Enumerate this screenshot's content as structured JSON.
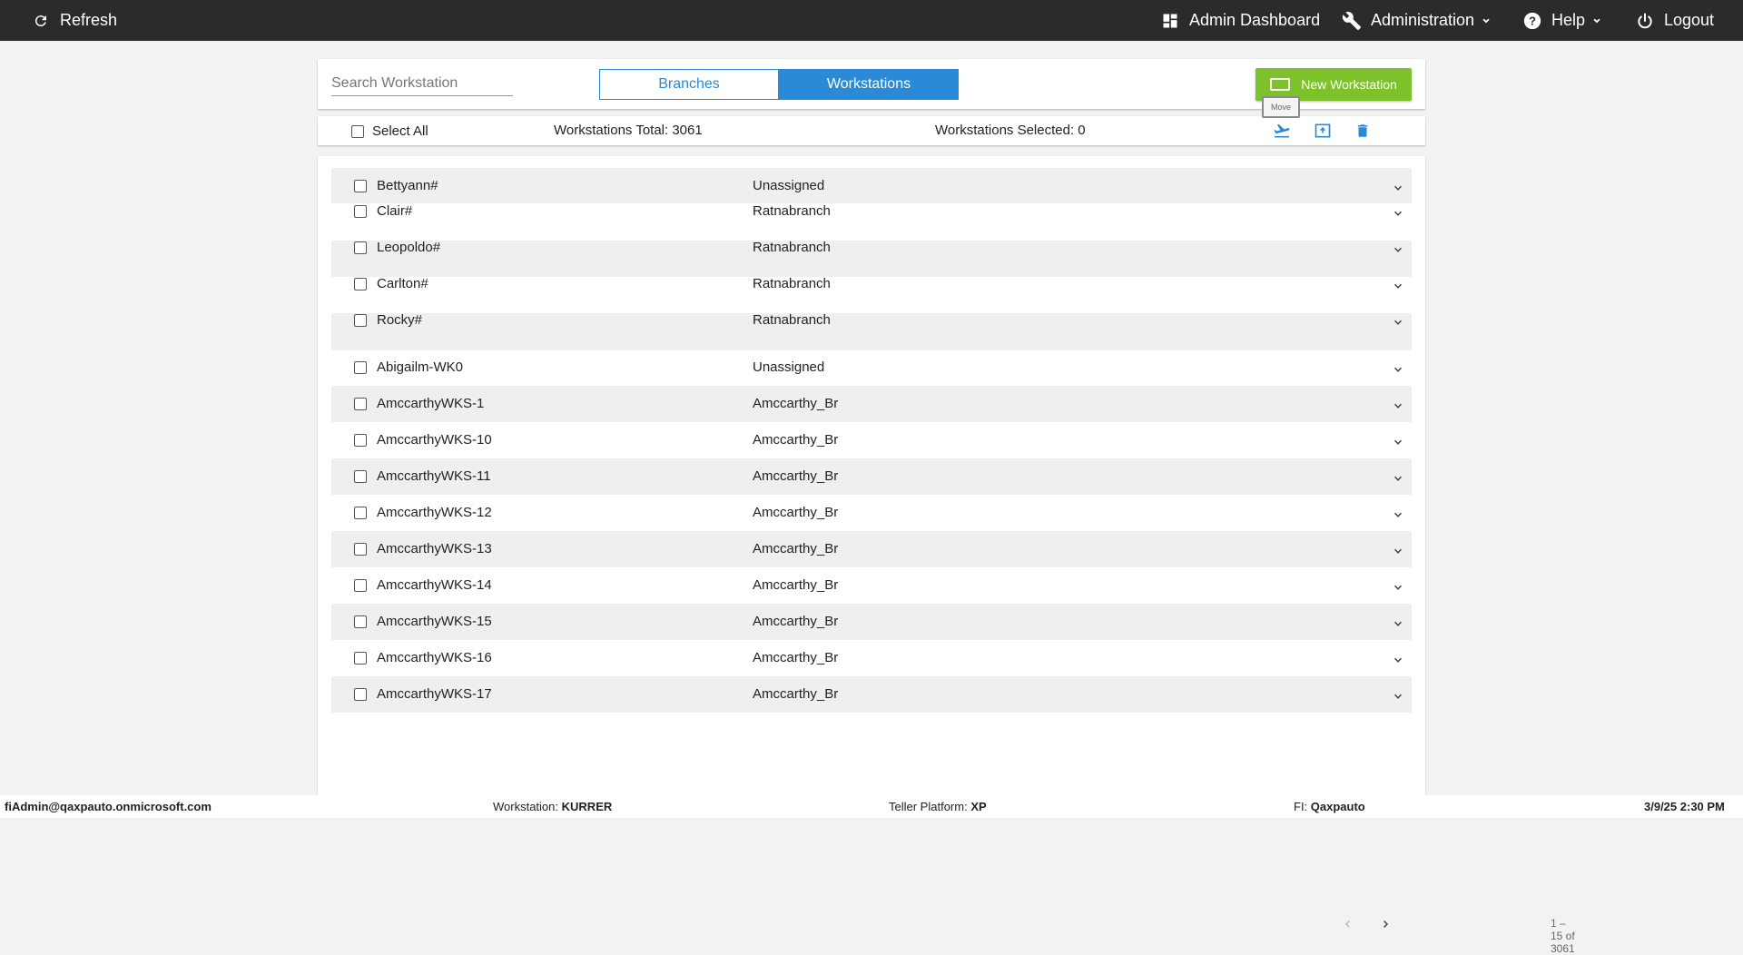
{
  "topbar": {
    "refresh_label": "Refresh",
    "admin_dashboard_label": "Admin Dashboard",
    "administration_label": "Administration",
    "help_label": "Help",
    "logout_label": "Logout"
  },
  "toolbar": {
    "search_placeholder": "Search Workstation",
    "tabs": [
      {
        "label": "Branches",
        "active": false
      },
      {
        "label": "Workstations",
        "active": true
      }
    ],
    "new_button_label": "New Workstation",
    "tooltip": "Move"
  },
  "selection": {
    "select_all_label": "Select All",
    "total_text": "Workstations Total: 3061",
    "selected_text": "Workstations Selected: 0",
    "actions": [
      "move-icon",
      "upload-icon",
      "delete-icon"
    ]
  },
  "rows": [
    {
      "name": "Bettyann#",
      "branch": "Unassigned"
    },
    {
      "name": "Clair#",
      "branch": "Ratnabranch"
    },
    {
      "name": "Leopoldo#",
      "branch": "Ratnabranch"
    },
    {
      "name": "Carlton#",
      "branch": "Ratnabranch"
    },
    {
      "name": "Rocky#",
      "branch": "Ratnabranch"
    },
    {
      "name": "Abigailm-WK0",
      "branch": "Unassigned"
    },
    {
      "name": "AmccarthyWKS-1",
      "branch": "Amccarthy_Br"
    },
    {
      "name": "AmccarthyWKS-10",
      "branch": "Amccarthy_Br"
    },
    {
      "name": "AmccarthyWKS-11",
      "branch": "Amccarthy_Br"
    },
    {
      "name": "AmccarthyWKS-12",
      "branch": "Amccarthy_Br"
    },
    {
      "name": "AmccarthyWKS-13",
      "branch": "Amccarthy_Br"
    },
    {
      "name": "AmccarthyWKS-14",
      "branch": "Amccarthy_Br"
    },
    {
      "name": "AmccarthyWKS-15",
      "branch": "Amccarthy_Br"
    },
    {
      "name": "AmccarthyWKS-16",
      "branch": "Amccarthy_Br"
    },
    {
      "name": "AmccarthyWKS-17",
      "branch": "Amccarthy_Br"
    }
  ],
  "pagination": {
    "range_text": "1 – 15 of 3061"
  },
  "footer": {
    "user": "fiAdmin@qaxpauto.onmicrosoft.com",
    "workstation_label": "Workstation:",
    "workstation_value": "KURRER",
    "platform_label": "Teller Platform:",
    "platform_value": "XP",
    "fi_label": "FI:",
    "fi_value": "Qaxpauto",
    "datetime": "3/9/25 2:30 PM"
  },
  "colors": {
    "accent": "#2b8ad8",
    "new_button": "#7dc22a",
    "topbar": "#2b2b2b"
  }
}
